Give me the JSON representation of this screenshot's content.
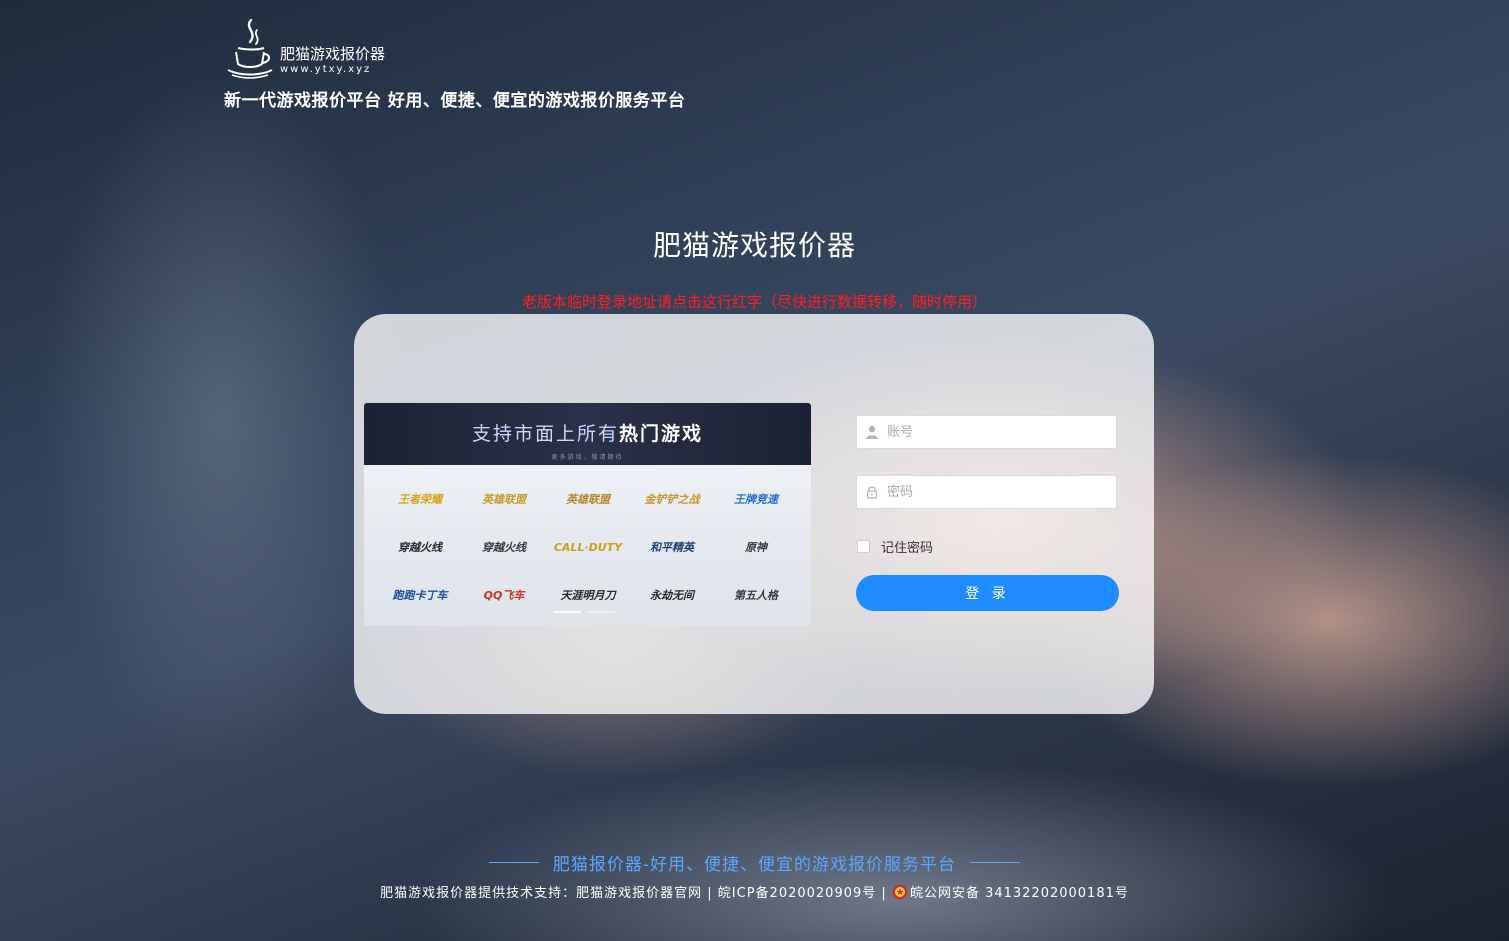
{
  "logo": {
    "name": "肥猫游戏报价器",
    "url": "www.ytxy.xyz",
    "icon": "teacup-logo-icon"
  },
  "header": {
    "slogan": "新一代游戏报价平台 好用、便捷、便宜的游戏报价服务平台"
  },
  "main": {
    "title": "肥猫游戏报价器",
    "old_link": "老版本临时登录地址请点击这行红字（尽快进行数据转移，随时停用）"
  },
  "banner": {
    "title_light": "支持市面上所有",
    "title_hot": "热门游戏",
    "subtitle": "更多游戏，敬请期待",
    "games": [
      {
        "name": "王者荣耀",
        "color": "#d9a21a"
      },
      {
        "name": "英雄联盟",
        "color": "#c89a2a"
      },
      {
        "name": "英雄联盟",
        "color": "#b8862a"
      },
      {
        "name": "金铲铲之战",
        "color": "#c8962a"
      },
      {
        "name": "王牌竞速",
        "color": "#1f6fd1"
      },
      {
        "name": "穿越火线",
        "color": "#2a2a2a"
      },
      {
        "name": "穿越火线",
        "color": "#3a3a3a"
      },
      {
        "name": "CALL·DUTY",
        "color": "#c8a21a"
      },
      {
        "name": "和平精英",
        "color": "#1f3f7a"
      },
      {
        "name": "原神",
        "color": "#3a3a3a"
      },
      {
        "name": "跑跑卡丁车",
        "color": "#1f4fa1"
      },
      {
        "name": "QQ飞车",
        "color": "#c4381f"
      },
      {
        "name": "天涯明月刀",
        "color": "#2a2a2a"
      },
      {
        "name": "永劫无间",
        "color": "#2a2a2a"
      },
      {
        "name": "第五人格",
        "color": "#3a3a3a"
      }
    ]
  },
  "form": {
    "account_placeholder": "账号",
    "password_placeholder": "密码",
    "remember_label": "记住密码",
    "login_label": "登 录"
  },
  "footer": {
    "slogan": "肥猫报价器-好用、便捷、便宜的游戏报价服务平台",
    "tech_support": "肥猫游戏报价器提供技术支持：肥猫游戏报价器官网",
    "icp": "皖ICP备2020020909号",
    "police": "皖公网安备 34132202000181号",
    "separator": "|"
  },
  "colors": {
    "accent": "#1e8cff",
    "alert": "#ff1f1f",
    "footer_slogan": "#5aa7ff"
  }
}
